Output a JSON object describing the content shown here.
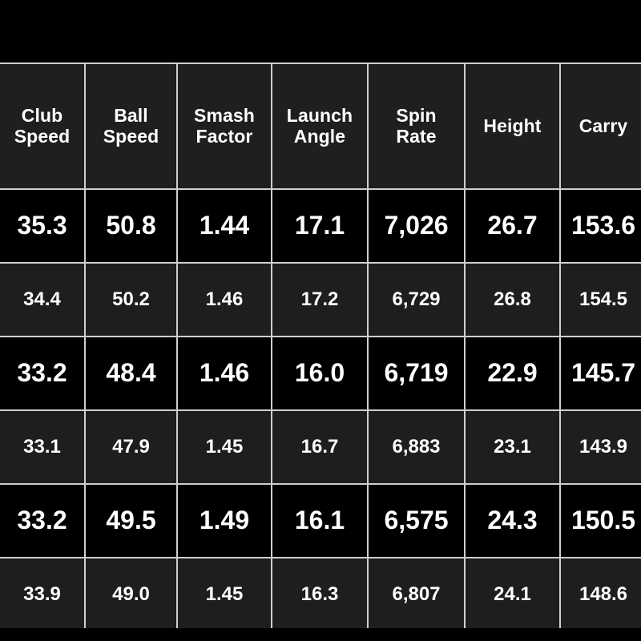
{
  "screen": {
    "background_color": "#000000",
    "letterbox_top_color": "#000000",
    "letterbox_bottom_color": "#000000"
  },
  "table": {
    "name": "launch-monitor-shot-table",
    "gridline_color": "#cfcfcf",
    "header_background": "#1f1f1f",
    "row_major_background": "#000000",
    "row_minor_background": "#1e1e1e",
    "colors": {
      "white": "#ffffff",
      "red": "#fd0000",
      "blue": "#0c5ca6"
    },
    "columns": [
      {
        "key": "club_speed",
        "line1": "Club",
        "line2": "Speed"
      },
      {
        "key": "ball_speed",
        "line1": "Ball",
        "line2": "Speed"
      },
      {
        "key": "smash_factor",
        "line1": "Smash",
        "line2": "Factor"
      },
      {
        "key": "launch_angle",
        "line1": "Launch",
        "line2": "Angle"
      },
      {
        "key": "spin_rate",
        "line1": "Spin",
        "line2": "Rate"
      },
      {
        "key": "height",
        "line1": "Height",
        "line2": ""
      },
      {
        "key": "carry",
        "line1": "Carry",
        "line2": ""
      }
    ],
    "rows": [
      {
        "style": "major",
        "cells": [
          {
            "value": "35.3",
            "color": "red"
          },
          {
            "value": "50.8",
            "color": "red"
          },
          {
            "value": "1.44",
            "color": "white"
          },
          {
            "value": "17.1",
            "color": "white"
          },
          {
            "value": "7,026",
            "color": "blue"
          },
          {
            "value": "26.7",
            "color": "white"
          },
          {
            "value": "153.6",
            "color": "white"
          }
        ]
      },
      {
        "style": "minor",
        "cells": [
          {
            "value": "34.4",
            "color": "white"
          },
          {
            "value": "50.2",
            "color": "white"
          },
          {
            "value": "1.46",
            "color": "white"
          },
          {
            "value": "17.2",
            "color": "red"
          },
          {
            "value": "6,729",
            "color": "white"
          },
          {
            "value": "26.8",
            "color": "red"
          },
          {
            "value": "154.5",
            "color": "red"
          }
        ]
      },
      {
        "style": "major",
        "cells": [
          {
            "value": "33.2",
            "color": "white"
          },
          {
            "value": "48.4",
            "color": "white"
          },
          {
            "value": "1.46",
            "color": "white"
          },
          {
            "value": "16.0",
            "color": "white"
          },
          {
            "value": "6,719",
            "color": "white"
          },
          {
            "value": "22.9",
            "color": "white"
          },
          {
            "value": "145.7",
            "color": "white"
          }
        ]
      },
      {
        "style": "minor",
        "cells": [
          {
            "value": "33.1",
            "color": "white"
          },
          {
            "value": "47.9",
            "color": "white"
          },
          {
            "value": "1.45",
            "color": "white"
          },
          {
            "value": "16.7",
            "color": "white"
          },
          {
            "value": "6,883",
            "color": "white"
          },
          {
            "value": "23.1",
            "color": "white"
          },
          {
            "value": "143.9",
            "color": "white"
          }
        ]
      },
      {
        "style": "major",
        "cells": [
          {
            "value": "33.2",
            "color": "white"
          },
          {
            "value": "49.5",
            "color": "white"
          },
          {
            "value": "1.49",
            "color": "red"
          },
          {
            "value": "16.1",
            "color": "white"
          },
          {
            "value": "6,575",
            "color": "red"
          },
          {
            "value": "24.3",
            "color": "white"
          },
          {
            "value": "150.5",
            "color": "white"
          }
        ]
      },
      {
        "style": "minor",
        "cells": [
          {
            "value": "33.9",
            "color": "white"
          },
          {
            "value": "49.0",
            "color": "white"
          },
          {
            "value": "1.45",
            "color": "white"
          },
          {
            "value": "16.3",
            "color": "white"
          },
          {
            "value": "6,807",
            "color": "white"
          },
          {
            "value": "24.1",
            "color": "white"
          },
          {
            "value": "148.6",
            "color": "white"
          }
        ]
      }
    ]
  }
}
